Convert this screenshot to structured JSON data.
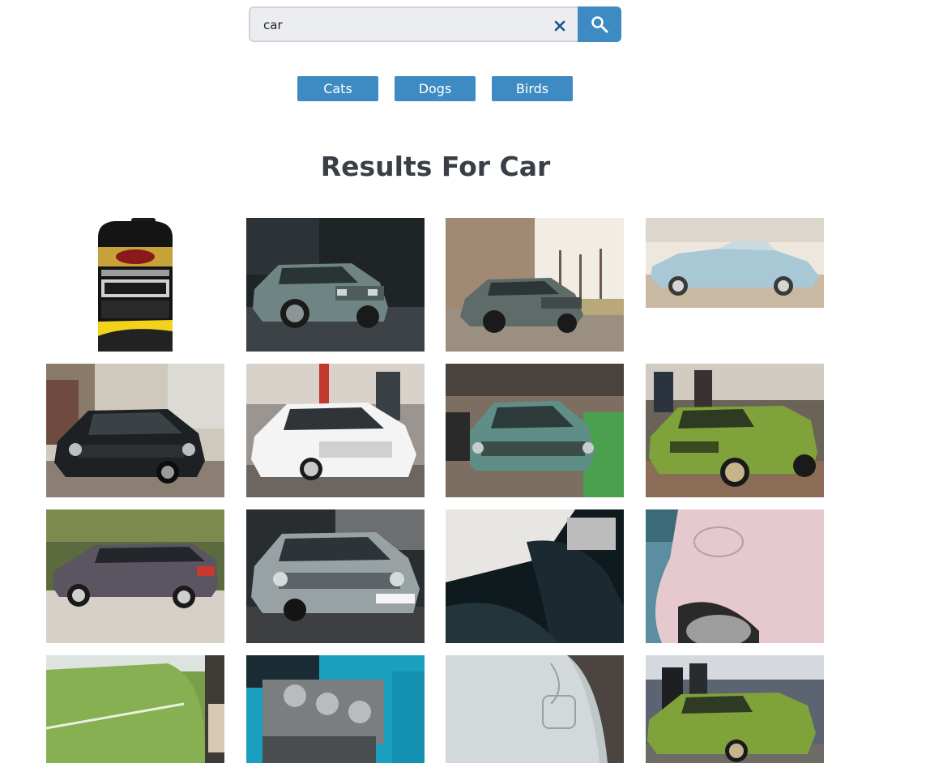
{
  "search": {
    "value": "car",
    "clear_icon": "close-icon",
    "submit_icon": "search-icon"
  },
  "categories": [
    "Cats",
    "Dogs",
    "Birds"
  ],
  "results": {
    "title": "Results For Car"
  },
  "colors": {
    "accent": "#3e8bc4",
    "title": "#3a3f47",
    "search_bg": "#ecedf0"
  },
  "images": [
    "car-care-product-bottle",
    "grey-vw-golf-front",
    "grey-vw-golf-building",
    "light-blue-convertible",
    "black-vw-golf-gti",
    "white-vw-golf",
    "teal-vw-golf",
    "green-vw-golf-classic",
    "grey-mercedes-wagon",
    "silver-vw-golf-plate",
    "car-interior-detail",
    "pink-car-fender",
    "green-car-panel",
    "engine-carburetors",
    "white-car-fuel-door",
    "green-vw-golf-show"
  ]
}
